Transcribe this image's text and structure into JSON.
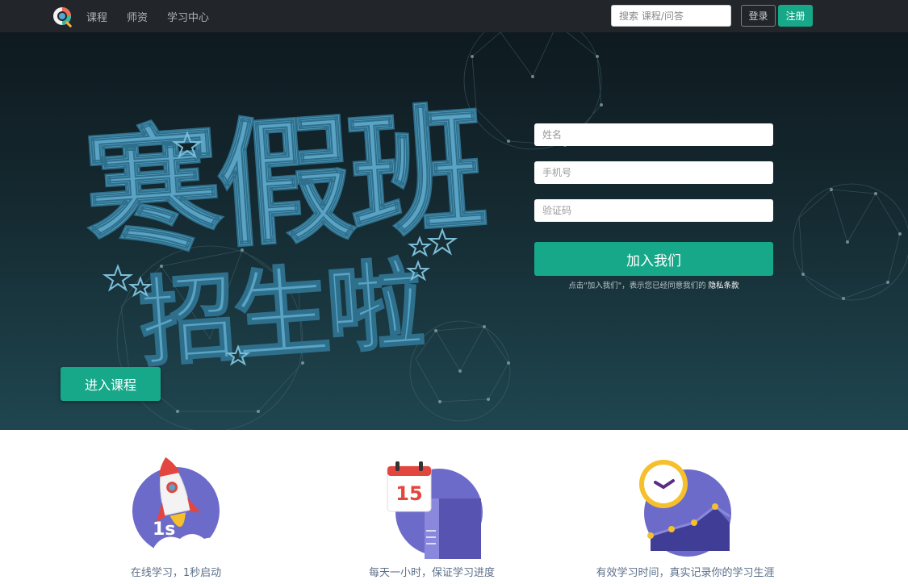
{
  "nav": {
    "links": [
      "课程",
      "师资",
      "学习中心"
    ],
    "search_placeholder": "搜索 课程/问答",
    "login_label": "登录",
    "register_label": "注册"
  },
  "hero": {
    "title_line1": "寒假班",
    "title_line2": "招生啦",
    "form": {
      "name_placeholder": "姓名",
      "phone_placeholder": "手机号",
      "code_placeholder": "验证码",
      "join_label": "加入我们",
      "agree_text": "点击\"加入我们\"，表示您已经同意我们的",
      "privacy_label": "隐私条款"
    },
    "enter_course_label": "进入课程"
  },
  "features": [
    {
      "icon": "rocket-icon",
      "label": "在线学习，1秒启动",
      "badge": "1s"
    },
    {
      "icon": "calendar-icon",
      "label": "每天一小时，保证学习进度",
      "badge": "15"
    },
    {
      "icon": "clock-chart-icon",
      "label": "有效学习时间，真实记录你的学习生涯"
    }
  ],
  "colors": {
    "navbar": "#22262b",
    "accent": "#17a88a",
    "hero_title": "#5aa3c4",
    "feature_circle": "#6d6bc9",
    "feature_text": "#5c6f8a"
  }
}
